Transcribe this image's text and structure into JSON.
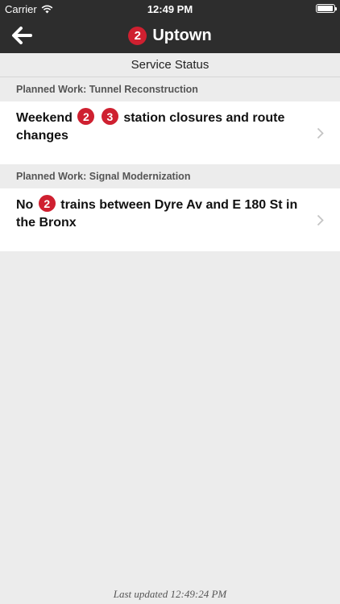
{
  "status_bar": {
    "carrier": "Carrier",
    "time": "12:49 PM"
  },
  "nav": {
    "route": "2",
    "title": "Uptown"
  },
  "section_title": "Service Status",
  "groups": [
    {
      "header": "Planned Work: Tunnel Reconstruction",
      "parts": {
        "a": "Weekend",
        "b1": "2",
        "b2": "3",
        "c": "station closures and route changes"
      }
    },
    {
      "header": "Planned Work: Signal Modernization",
      "parts": {
        "a": "No",
        "b1": "2",
        "c": "trains between Dyre Av and E 180 St in the Bronx"
      }
    }
  ],
  "footer": "Last updated 12:49:24 PM",
  "colors": {
    "bar": "#2d2d2d",
    "bullet_red": "#cf2030",
    "background": "#ececec"
  },
  "icons": [
    "wifi-icon",
    "battery-icon",
    "back-arrow-icon",
    "chevron-right-icon"
  ]
}
